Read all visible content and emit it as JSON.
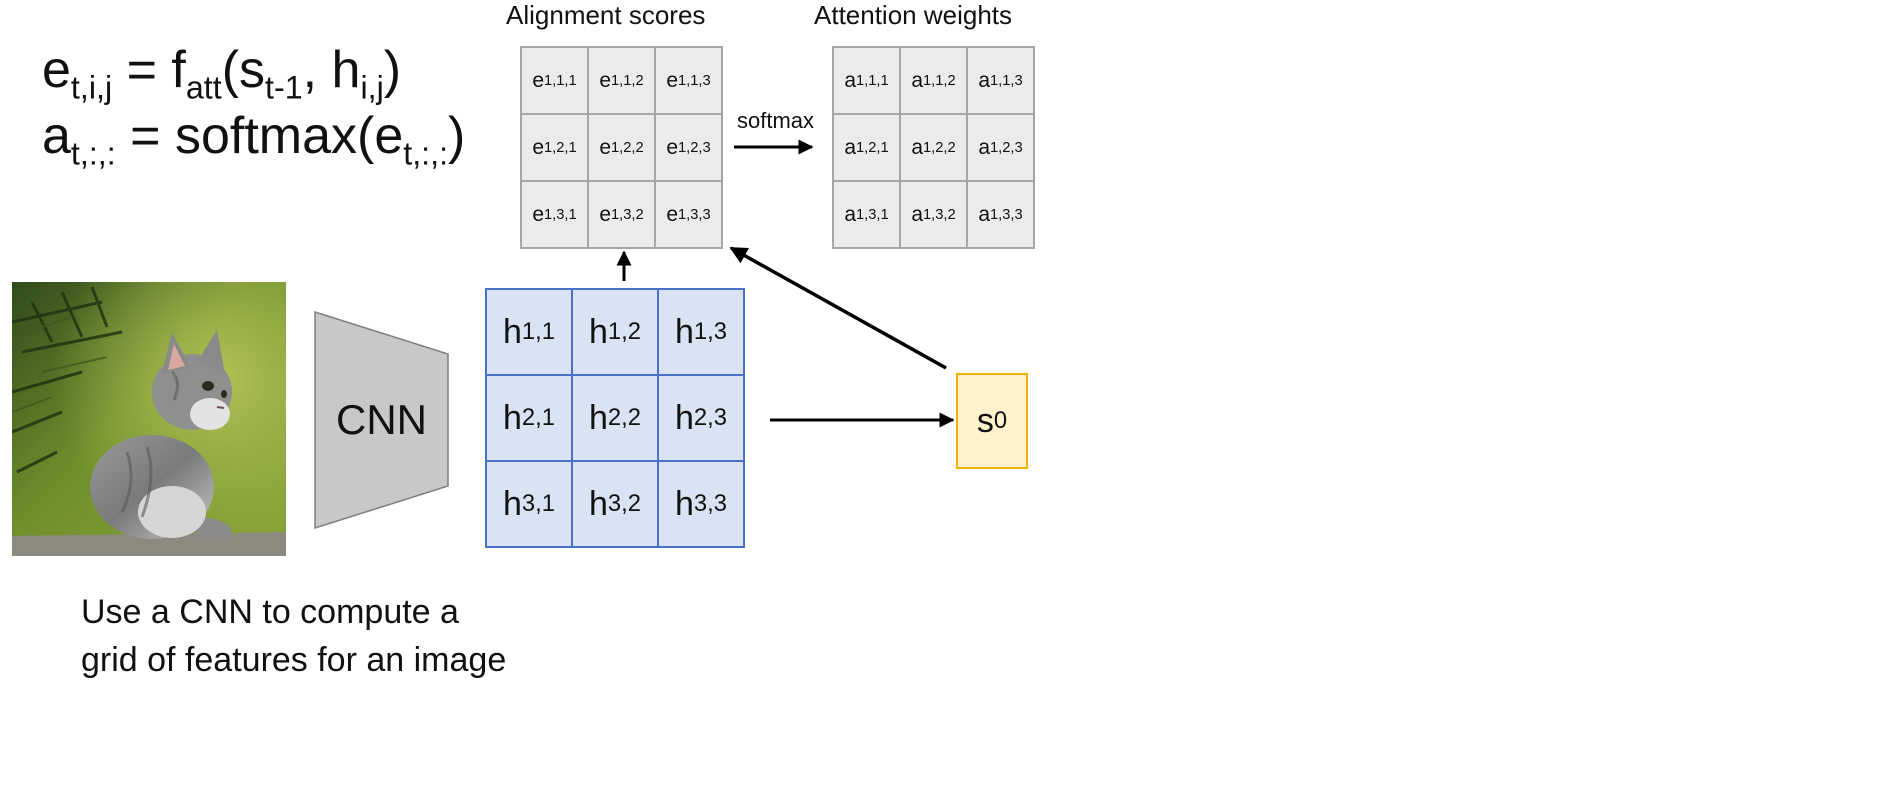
{
  "equations": {
    "line1": {
      "a": "e",
      "a_sub": "t,i,j",
      "b": " = f",
      "b_sub": "att",
      "c": "(s",
      "c_sub": "t-1",
      "d": ", h",
      "d_sub": "i,j",
      "e": ")"
    },
    "line2": {
      "a": "a",
      "a_sub": "t,:,:",
      "b": " = softmax(e",
      "b_sub": "t,:,:",
      "c": ")"
    }
  },
  "alignment": {
    "title": "Alignment scores",
    "cells": [
      {
        "base": "e",
        "sub": "1,1,1"
      },
      {
        "base": "e",
        "sub": "1,1,2"
      },
      {
        "base": "e",
        "sub": "1,1,3"
      },
      {
        "base": "e",
        "sub": "1,2,1"
      },
      {
        "base": "e",
        "sub": "1,2,2"
      },
      {
        "base": "e",
        "sub": "1,2,3"
      },
      {
        "base": "e",
        "sub": "1,3,1"
      },
      {
        "base": "e",
        "sub": "1,3,2"
      },
      {
        "base": "e",
        "sub": "1,3,3"
      }
    ]
  },
  "attention": {
    "title": "Attention weights",
    "cells": [
      {
        "base": "a",
        "sub": "1,1,1"
      },
      {
        "base": "a",
        "sub": "1,1,2"
      },
      {
        "base": "a",
        "sub": "1,1,3"
      },
      {
        "base": "a",
        "sub": "1,2,1"
      },
      {
        "base": "a",
        "sub": "1,2,2"
      },
      {
        "base": "a",
        "sub": "1,2,3"
      },
      {
        "base": "a",
        "sub": "1,3,1"
      },
      {
        "base": "a",
        "sub": "1,3,2"
      },
      {
        "base": "a",
        "sub": "1,3,3"
      }
    ]
  },
  "softmax_label": "softmax",
  "cnn_label": "CNN",
  "features": {
    "cells": [
      {
        "base": "h",
        "sub": "1,1"
      },
      {
        "base": "h",
        "sub": "1,2"
      },
      {
        "base": "h",
        "sub": "1,3"
      },
      {
        "base": "h",
        "sub": "2,1"
      },
      {
        "base": "h",
        "sub": "2,2"
      },
      {
        "base": "h",
        "sub": "2,3"
      },
      {
        "base": "h",
        "sub": "3,1"
      },
      {
        "base": "h",
        "sub": "3,2"
      },
      {
        "base": "h",
        "sub": "3,3"
      }
    ]
  },
  "state": {
    "base": "s",
    "sub": "0"
  },
  "caption": {
    "line1": "Use a CNN to compute a",
    "line2": "grid of features for an image"
  },
  "colors": {
    "feature_fill": "#dae3f3",
    "feature_border": "#4a72c4",
    "state_fill": "#fff2cc",
    "state_border": "#f2b200",
    "score_fill": "#ebebeb",
    "score_border": "#a6a6a6",
    "cnn_fill": "#c8c8c8"
  },
  "image": {
    "subject": "kitten photo"
  }
}
